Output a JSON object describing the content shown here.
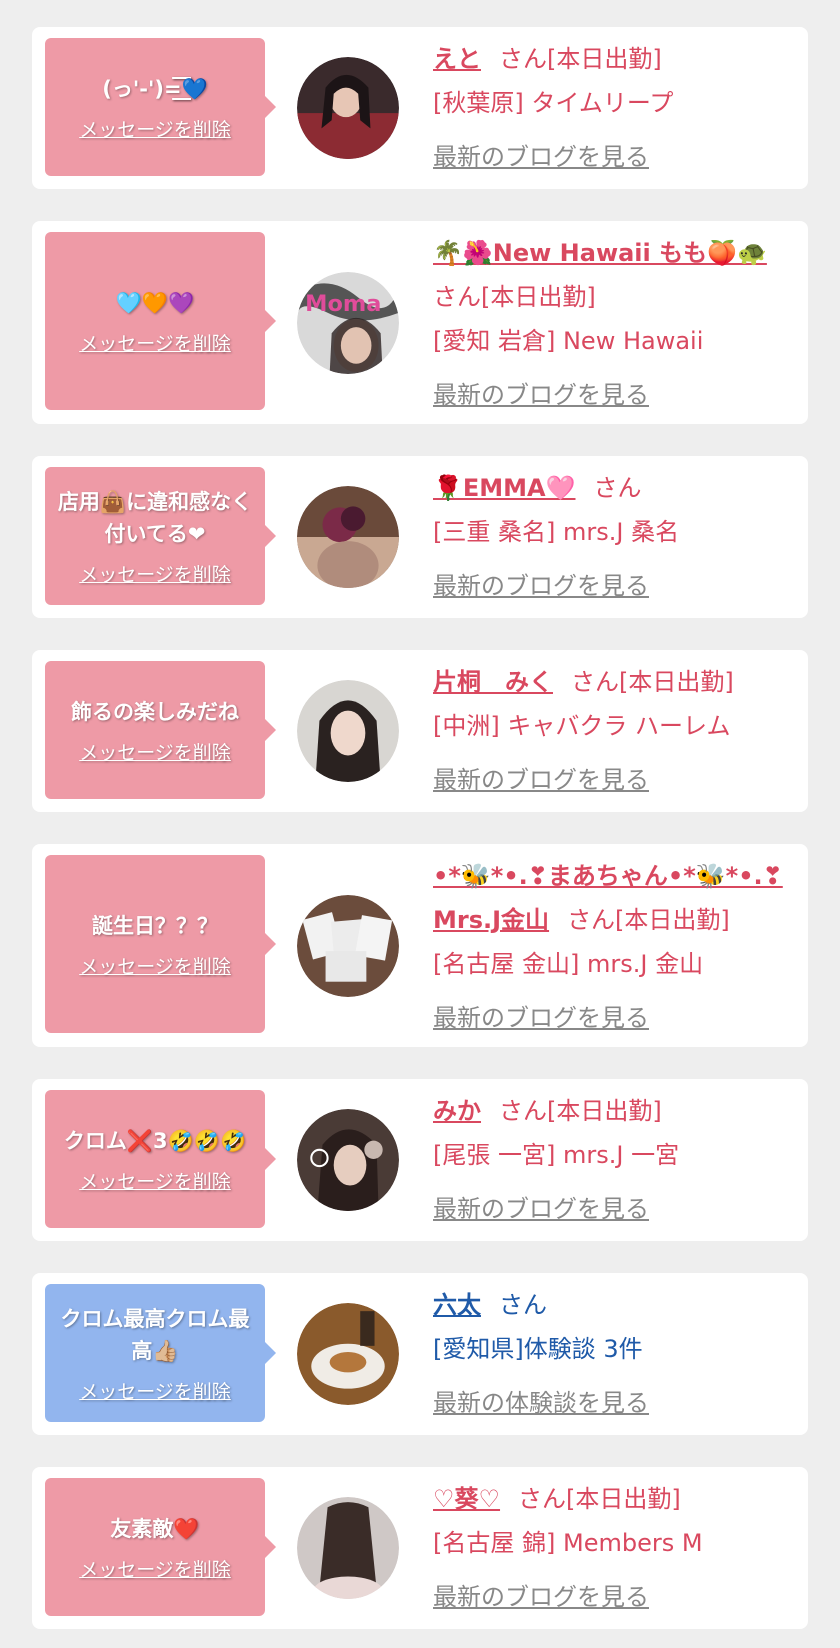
{
  "delete_label": "メッセージを削除",
  "colors": {
    "pink_bubble": "#ee9aa6",
    "blue_bubble": "#92b5ee",
    "pink_text": "#d9485f",
    "blue_text": "#1f5aa8",
    "gray_link": "#888888"
  },
  "items": [
    {
      "message": "(っ'-')=͟͟͞͞💙",
      "name": "えと",
      "suffix": "さん[本日出勤]",
      "shop": "[秋葉原] タイムリープ",
      "link": "最新のブログを見る",
      "theme": "pink",
      "avatar_icon": "girl-photo"
    },
    {
      "message": "🩵🧡💜",
      "name": "🌴🌺New Hawaii もも🍑🐢",
      "suffix": "さん[本日出勤]",
      "shop": "[愛知 岩倉] New Hawaii",
      "link": "最新のブログを見る",
      "theme": "pink",
      "avatar_icon": "girl-photo"
    },
    {
      "message": "店用👜に違和感なく付いてる❤",
      "name": "🌹EMMA🩷",
      "suffix": "さん",
      "shop": "[三重 桑名] mrs.J 桑名",
      "link": "最新のブログを見る",
      "theme": "pink",
      "avatar_icon": "girl-photo"
    },
    {
      "message": "飾るの楽しみだね",
      "name": "片桐　みく",
      "suffix": "さん[本日出勤]",
      "shop": "[中洲] キャバクラ ハーレム",
      "link": "最新のブログを見る",
      "theme": "pink",
      "avatar_icon": "girl-photo"
    },
    {
      "message": "誕生日？？？",
      "name": "•*🐝*•.❣まあちゃん•*🐝*•.❣Mrs.J金山",
      "suffix": "さん[本日出勤]",
      "shop": "[名古屋 金山] mrs.J 金山",
      "link": "最新のブログを見る",
      "theme": "pink",
      "avatar_icon": "photo-cards"
    },
    {
      "message": "クロム❌3🤣🤣🤣",
      "name": "みか",
      "suffix": "さん[本日出勤]",
      "shop": "[尾張 一宮] mrs.J 一宮",
      "link": "最新のブログを見る",
      "theme": "pink",
      "avatar_icon": "girl-photo"
    },
    {
      "message": "クロム最高クロム最高👍🏼",
      "name": "六太",
      "suffix": "さん",
      "shop": "[愛知県]体験談 3件",
      "link": "最新の体験談を見る",
      "theme": "blue",
      "avatar_icon": "food-photo"
    },
    {
      "message": "友素敵❤️",
      "name": "♡葵♡",
      "suffix": "さん[本日出勤]",
      "shop": "[名古屋 錦] Members M",
      "link": "最新のブログを見る",
      "theme": "pink",
      "avatar_icon": "girl-photo"
    }
  ]
}
